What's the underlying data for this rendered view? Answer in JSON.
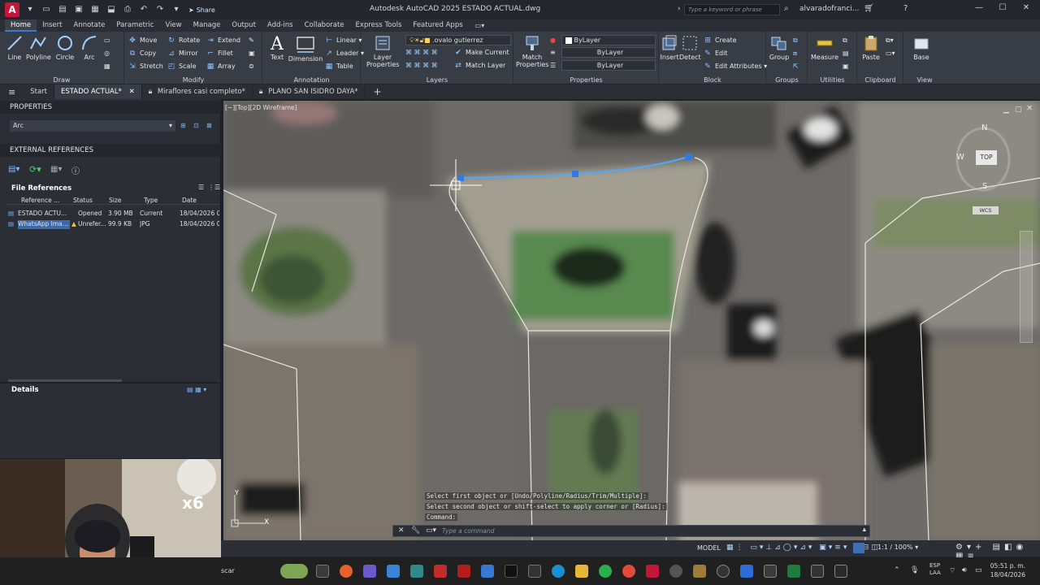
{
  "window": {
    "title": "Autodesk AutoCAD 2025    ESTADO ACTUAL.dwg",
    "search_placeholder": "Type a keyword or phrase",
    "user": "alvaradofranci...",
    "share": "Share",
    "app_letter": "A"
  },
  "menu_tabs": [
    "Home",
    "Insert",
    "Annotate",
    "Parametric",
    "View",
    "Manage",
    "Output",
    "Add-ins",
    "Collaborate",
    "Express Tools",
    "Featured Apps"
  ],
  "ribbon": {
    "draw": {
      "title": "Draw",
      "line": "Line",
      "polyline": "Polyline",
      "circle": "Circle",
      "arc": "Arc"
    },
    "modify": {
      "title": "Modify",
      "move": "Move",
      "rotate": "Rotate",
      "extend": "Extend",
      "copy": "Copy",
      "mirror": "Mirror",
      "fillet": "Fillet",
      "stretch": "Stretch",
      "scale": "Scale",
      "array": "Array"
    },
    "annotation": {
      "title": "Annotation",
      "text": "Text",
      "dimension": "Dimension",
      "linear": "Linear",
      "leader": "Leader",
      "table": "Table"
    },
    "layers": {
      "title": "Layers",
      "layer_properties": "Layer Properties",
      "current_layer": ".ovalo gutierrez",
      "make_current": "Make Current",
      "match_layer": "Match Layer"
    },
    "properties": {
      "title": "Properties",
      "match_properties": "Match Properties",
      "bylayer_color": "ByLayer",
      "bylayer_line1": "ByLayer",
      "bylayer_line2": "ByLayer"
    },
    "block": {
      "title": "Block",
      "insert": "Insert",
      "detect": "Detect",
      "create": "Create",
      "edit": "Edit",
      "edit_attributes": "Edit Attributes"
    },
    "groups": {
      "title": "Groups",
      "group": "Group"
    },
    "utilities": {
      "title": "Utilities",
      "measure": "Measure"
    },
    "clipboard": {
      "title": "Clipboard",
      "paste": "Paste"
    },
    "view": {
      "title": "View",
      "base": "Base"
    }
  },
  "doc_tabs": [
    "Start",
    "ESTADO ACTUAL*",
    "Miraflores casi completo*",
    "PLANO SAN ISIDRO DAYA*"
  ],
  "left_panel": {
    "properties_title": "PROPERTIES",
    "properties_select": "Arc",
    "xref_title": "EXTERNAL REFERENCES",
    "file_refs_title": "File References",
    "columns": [
      "Reference ...",
      "Status",
      "Size",
      "Type",
      "Date"
    ],
    "rows": [
      [
        "ESTADO ACTU...",
        "Opened",
        "3.90 MB",
        "Current",
        "18/04/2026 0..."
      ],
      [
        "WhatsApp Ima...",
        "Unrefer...",
        "99.9 KB",
        "JPG",
        "18/04/2026 0..."
      ]
    ],
    "details_title": "Details"
  },
  "viewport": {
    "label": "[−][Top][2D Wireframe]",
    "compass": {
      "n": "N",
      "w": "W",
      "s": "S",
      "top": "TOP",
      "wcs": "WCS"
    }
  },
  "command": {
    "history": [
      "Select first object or [Undo/Polyline/Radius/Trim/Multiple]:",
      "Select second object or shift-select to apply corner or [Radius]:",
      "Command:"
    ],
    "placeholder": "Type a command"
  },
  "statusbar": {
    "model": "MODEL",
    "scale": "1:1 / 100%"
  },
  "taskbar": {
    "search": "scar",
    "lang": "ESP\nLAA",
    "time": "05:51 p. m.",
    "date": "18/04/2026"
  },
  "webcam": {
    "badge": "x6"
  }
}
